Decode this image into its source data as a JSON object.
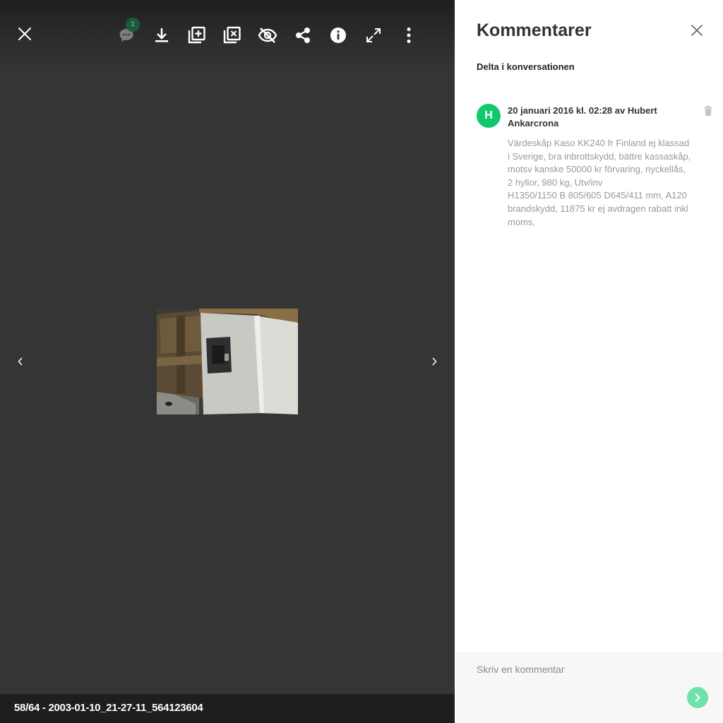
{
  "toolbar": {
    "comment_count": "1",
    "icons": [
      "close-icon",
      "comment-icon",
      "download-icon",
      "add-to-album-icon",
      "remove-from-album-icon",
      "hide-icon",
      "share-icon",
      "info-icon",
      "fullscreen-icon",
      "more-icon"
    ]
  },
  "footer": {
    "caption": "58/64 - 2003-01-10_21-27-11_564123604"
  },
  "comments_panel": {
    "title": "Kommentarer",
    "subtitle": "Delta i konversationen",
    "comments": [
      {
        "avatar_initial": "H",
        "meta": "20 januari 2016 kl. 02:28 av Hubert Ankarcrona",
        "body": "Värdeskåp Kaso KK240 fr Finland ej klassad i Sverige, bra inbrottskydd, bättre kassaskåp, motsv kanske 50000 kr förvaring, nyckellås, 2 hyllor, 980 kg, Utv/inv\nH1350/1150 B 805/605 D645/411 mm, A120 brandskydd, 11875 kr ej avdragen rabatt inkl moms,"
      }
    ],
    "composer": {
      "placeholder": "Skriv en kommentar"
    }
  },
  "colors": {
    "viewer_bg": "#353535",
    "avatar": "#12c86c",
    "send_button": "#6fe1ab",
    "badge": "#1d5a3d"
  }
}
